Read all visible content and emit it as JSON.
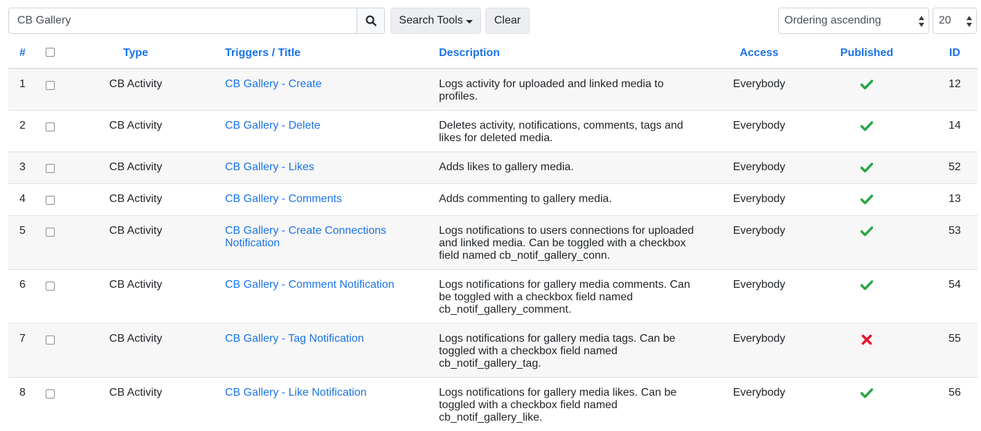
{
  "search": {
    "value": "CB Gallery",
    "placeholder": "Search"
  },
  "toolbar": {
    "search_tools_label": "Search Tools",
    "clear_label": "Clear"
  },
  "ordering": {
    "selected": "Ordering ascending"
  },
  "limit": {
    "selected": "20"
  },
  "columns": {
    "num": "#",
    "type": "Type",
    "title": "Triggers / Title",
    "description": "Description",
    "access": "Access",
    "published": "Published",
    "id": "ID"
  },
  "colors": {
    "link": "#1a73e8",
    "published": "#28a745",
    "unpublished": "#e8112d"
  },
  "rows": [
    {
      "num": "1",
      "type": "CB Activity",
      "title": "CB Gallery - Create",
      "description": "Logs activity for uploaded and linked media to profiles.",
      "access": "Everybody",
      "published": true,
      "id": "12"
    },
    {
      "num": "2",
      "type": "CB Activity",
      "title": "CB Gallery - Delete",
      "description": "Deletes activity, notifications, comments, tags and likes for deleted media.",
      "access": "Everybody",
      "published": true,
      "id": "14"
    },
    {
      "num": "3",
      "type": "CB Activity",
      "title": "CB Gallery - Likes",
      "description": "Adds likes to gallery media.",
      "access": "Everybody",
      "published": true,
      "id": "52"
    },
    {
      "num": "4",
      "type": "CB Activity",
      "title": "CB Gallery - Comments",
      "description": "Adds commenting to gallery media.",
      "access": "Everybody",
      "published": true,
      "id": "13"
    },
    {
      "num": "5",
      "type": "CB Activity",
      "title": "CB Gallery - Create Connections Notification",
      "description": "Logs notifications to users connections for uploaded and linked media. Can be toggled with a checkbox field named cb_notif_gallery_conn.",
      "access": "Everybody",
      "published": true,
      "id": "53"
    },
    {
      "num": "6",
      "type": "CB Activity",
      "title": "CB Gallery - Comment Notification",
      "description": "Logs notifications for gallery media comments. Can be toggled with a checkbox field named cb_notif_gallery_comment.",
      "access": "Everybody",
      "published": true,
      "id": "54"
    },
    {
      "num": "7",
      "type": "CB Activity",
      "title": "CB Gallery - Tag Notification",
      "description": "Logs notifications for gallery media tags. Can be toggled with a checkbox field named cb_notif_gallery_tag.",
      "access": "Everybody",
      "published": false,
      "id": "55"
    },
    {
      "num": "8",
      "type": "CB Activity",
      "title": "CB Gallery - Like Notification",
      "description": "Logs notifications for gallery media likes. Can be toggled with a checkbox field named cb_notif_gallery_like.",
      "access": "Everybody",
      "published": true,
      "id": "56"
    }
  ]
}
